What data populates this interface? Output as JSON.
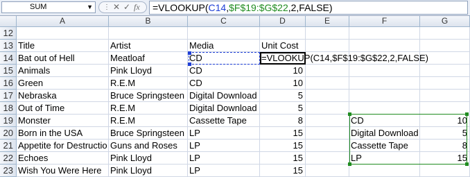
{
  "formula_bar": {
    "name_box": "SUM",
    "cancel_icon": "✕",
    "enter_icon": "✓",
    "fx_label": "fx",
    "formula": {
      "prefix": "=VLOOKUP(",
      "ref1": "C14",
      "sep1": ",",
      "ref2": "$F$19:$G$22",
      "suffix": ",2,FALSE)"
    }
  },
  "columns": [
    "A",
    "B",
    "C",
    "D",
    "E",
    "F",
    "G"
  ],
  "rows": [
    "12",
    "13",
    "14",
    "15",
    "16",
    "17",
    "18",
    "19",
    "20",
    "21",
    "22",
    "23"
  ],
  "sheet": {
    "headers": {
      "title": "Title",
      "artist": "Artist",
      "media": "Media",
      "unit_cost": "Unit Cost"
    },
    "records": [
      {
        "title": "Bat out of Hell",
        "artist": "Meatloaf",
        "media": "CD",
        "cost": "=VLOOKUP(C14,$F$19:$G$22,2,FALSE)"
      },
      {
        "title": "Animals",
        "artist": "Pink Lloyd",
        "media": "CD",
        "cost": "10"
      },
      {
        "title": "Green",
        "artist": "R.E.M",
        "media": "CD",
        "cost": "10"
      },
      {
        "title": "Nebraska",
        "artist": "Bruce Springsteen",
        "media": "Digital Download",
        "cost": "5"
      },
      {
        "title": "Out of Time",
        "artist": "R.E.M",
        "media": "Digital Download",
        "cost": "5"
      },
      {
        "title": "Monster",
        "artist": "R.E.M",
        "media": "Cassette Tape",
        "cost": "8"
      },
      {
        "title": "Born in the USA",
        "artist": "Bruce Springsteen",
        "media": "LP",
        "cost": "15"
      },
      {
        "title": "Appetite for Destructio",
        "artist": "Guns and Roses",
        "media": "LP",
        "cost": "15"
      },
      {
        "title": "Echoes",
        "artist": "Pink Lloyd",
        "media": "LP",
        "cost": "15"
      },
      {
        "title": "Wish You Were Here",
        "artist": "Pink Lloyd",
        "media": "LP",
        "cost": "15"
      }
    ],
    "lookup": [
      {
        "media": "CD",
        "price": "10"
      },
      {
        "media": "Digital Download",
        "price": "5"
      },
      {
        "media": "Cassette Tape",
        "price": "8"
      },
      {
        "media": "LP",
        "price": "15"
      }
    ]
  }
}
